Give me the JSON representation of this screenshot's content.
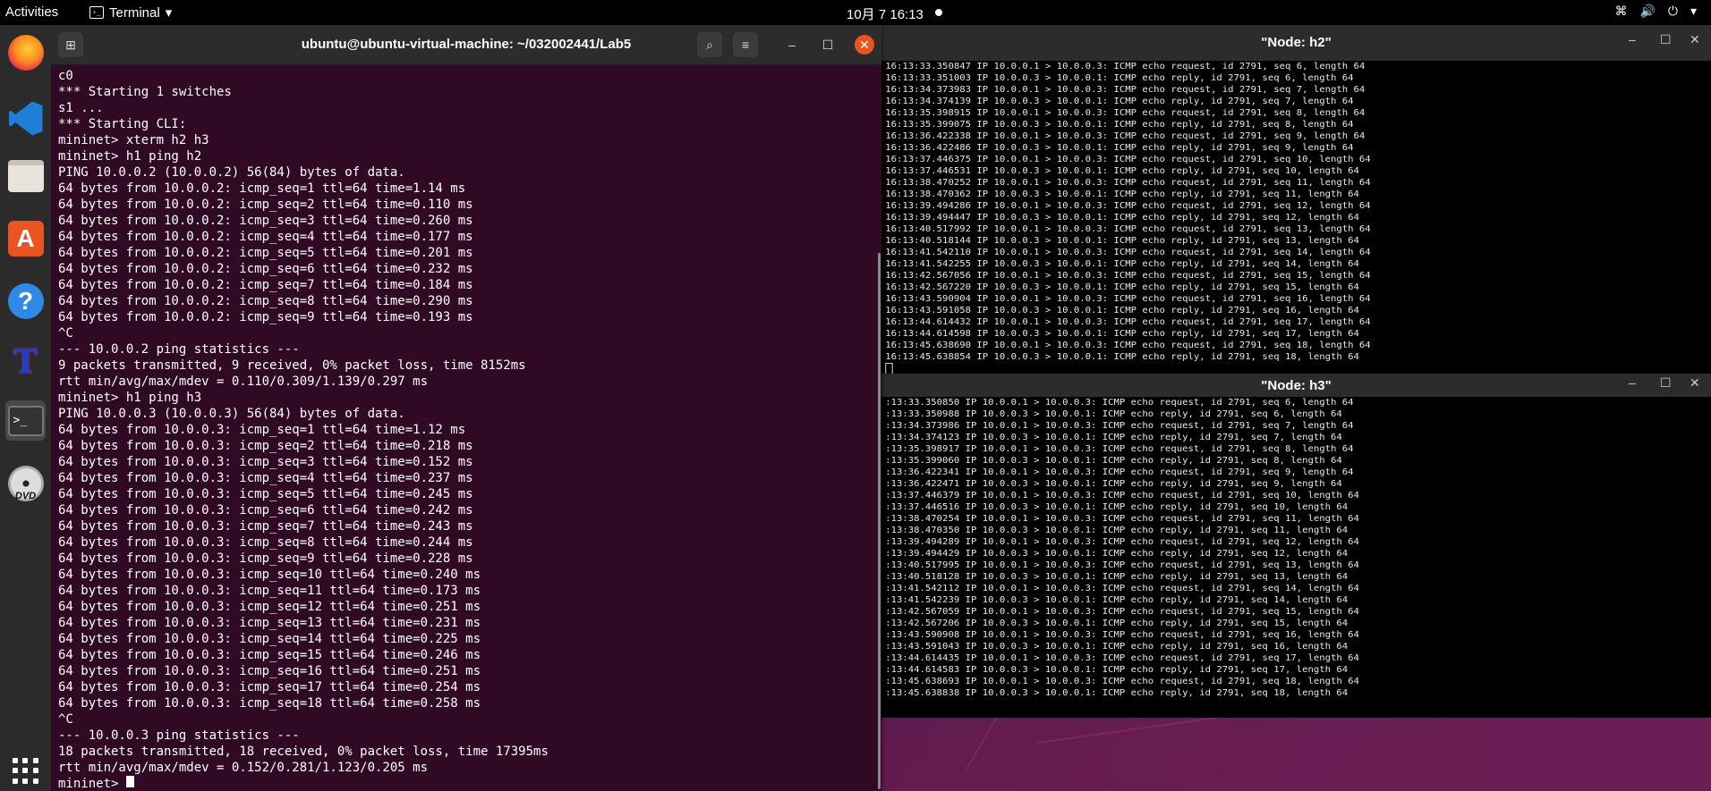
{
  "topbar": {
    "activities": "Activities",
    "app_name": "Terminal",
    "clock": "10月 7  16:13",
    "tray": [
      "⌘",
      "🔊",
      "⏻",
      "▾"
    ]
  },
  "dock": {
    "items": [
      "firefox-icon",
      "vscode-icon",
      "files-icon",
      "app-center-icon",
      "help-icon",
      "tx-icon",
      "terminal-icon",
      "dvd-icon",
      "show-apps-icon"
    ],
    "dvd_label": "DVD"
  },
  "terminal": {
    "title": "ubuntu@ubuntu-virtual-machine: ~/032002441/Lab5",
    "lines": [
      "c0",
      "*** Starting 1 switches",
      "s1 ...",
      "*** Starting CLI:",
      "mininet> xterm h2 h3",
      "mininet> h1 ping h2",
      "PING 10.0.0.2 (10.0.0.2) 56(84) bytes of data.",
      "64 bytes from 10.0.0.2: icmp_seq=1 ttl=64 time=1.14 ms",
      "64 bytes from 10.0.0.2: icmp_seq=2 ttl=64 time=0.110 ms",
      "64 bytes from 10.0.0.2: icmp_seq=3 ttl=64 time=0.260 ms",
      "64 bytes from 10.0.0.2: icmp_seq=4 ttl=64 time=0.177 ms",
      "64 bytes from 10.0.0.2: icmp_seq=5 ttl=64 time=0.201 ms",
      "64 bytes from 10.0.0.2: icmp_seq=6 ttl=64 time=0.232 ms",
      "64 bytes from 10.0.0.2: icmp_seq=7 ttl=64 time=0.184 ms",
      "64 bytes from 10.0.0.2: icmp_seq=8 ttl=64 time=0.290 ms",
      "64 bytes from 10.0.0.2: icmp_seq=9 ttl=64 time=0.193 ms",
      "^C",
      "--- 10.0.0.2 ping statistics ---",
      "9 packets transmitted, 9 received, 0% packet loss, time 8152ms",
      "rtt min/avg/max/mdev = 0.110/0.309/1.139/0.297 ms",
      "mininet> h1 ping h3",
      "PING 10.0.0.3 (10.0.0.3) 56(84) bytes of data.",
      "64 bytes from 10.0.0.3: icmp_seq=1 ttl=64 time=1.12 ms",
      "64 bytes from 10.0.0.3: icmp_seq=2 ttl=64 time=0.218 ms",
      "64 bytes from 10.0.0.3: icmp_seq=3 ttl=64 time=0.152 ms",
      "64 bytes from 10.0.0.3: icmp_seq=4 ttl=64 time=0.237 ms",
      "64 bytes from 10.0.0.3: icmp_seq=5 ttl=64 time=0.245 ms",
      "64 bytes from 10.0.0.3: icmp_seq=6 ttl=64 time=0.242 ms",
      "64 bytes from 10.0.0.3: icmp_seq=7 ttl=64 time=0.243 ms",
      "64 bytes from 10.0.0.3: icmp_seq=8 ttl=64 time=0.244 ms",
      "64 bytes from 10.0.0.3: icmp_seq=9 ttl=64 time=0.228 ms",
      "64 bytes from 10.0.0.3: icmp_seq=10 ttl=64 time=0.240 ms",
      "64 bytes from 10.0.0.3: icmp_seq=11 ttl=64 time=0.173 ms",
      "64 bytes from 10.0.0.3: icmp_seq=12 ttl=64 time=0.251 ms",
      "64 bytes from 10.0.0.3: icmp_seq=13 ttl=64 time=0.231 ms",
      "64 bytes from 10.0.0.3: icmp_seq=14 ttl=64 time=0.225 ms",
      "64 bytes from 10.0.0.3: icmp_seq=15 ttl=64 time=0.246 ms",
      "64 bytes from 10.0.0.3: icmp_seq=16 ttl=64 time=0.251 ms",
      "64 bytes from 10.0.0.3: icmp_seq=17 ttl=64 time=0.254 ms",
      "64 bytes from 10.0.0.3: icmp_seq=18 ttl=64 time=0.258 ms",
      "^C",
      "--- 10.0.0.3 ping statistics ---",
      "18 packets transmitted, 18 received, 0% packet loss, time 17395ms",
      "rtt min/avg/max/mdev = 0.152/0.281/1.123/0.205 ms"
    ],
    "prompt": "mininet> "
  },
  "xterm_h2": {
    "title": "\"Node: h2\"",
    "lines": [
      "16:13:33.350847 IP 10.0.0.1 > 10.0.0.3: ICMP echo request, id 2791, seq 6, length 64",
      "16:13:33.351003 IP 10.0.0.3 > 10.0.0.1: ICMP echo reply, id 2791, seq 6, length 64",
      "16:13:34.373983 IP 10.0.0.1 > 10.0.0.3: ICMP echo request, id 2791, seq 7, length 64",
      "16:13:34.374139 IP 10.0.0.3 > 10.0.0.1: ICMP echo reply, id 2791, seq 7, length 64",
      "16:13:35.398915 IP 10.0.0.1 > 10.0.0.3: ICMP echo request, id 2791, seq 8, length 64",
      "16:13:35.399075 IP 10.0.0.3 > 10.0.0.1: ICMP echo reply, id 2791, seq 8, length 64",
      "16:13:36.422338 IP 10.0.0.1 > 10.0.0.3: ICMP echo request, id 2791, seq 9, length 64",
      "16:13:36.422486 IP 10.0.0.3 > 10.0.0.1: ICMP echo reply, id 2791, seq 9, length 64",
      "16:13:37.446375 IP 10.0.0.1 > 10.0.0.3: ICMP echo request, id 2791, seq 10, length 64",
      "16:13:37.446531 IP 10.0.0.3 > 10.0.0.1: ICMP echo reply, id 2791, seq 10, length 64",
      "16:13:38.470252 IP 10.0.0.1 > 10.0.0.3: ICMP echo request, id 2791, seq 11, length 64",
      "16:13:38.470362 IP 10.0.0.3 > 10.0.0.1: ICMP echo reply, id 2791, seq 11, length 64",
      "16:13:39.494286 IP 10.0.0.1 > 10.0.0.3: ICMP echo request, id 2791, seq 12, length 64",
      "16:13:39.494447 IP 10.0.0.3 > 10.0.0.1: ICMP echo reply, id 2791, seq 12, length 64",
      "16:13:40.517992 IP 10.0.0.1 > 10.0.0.3: ICMP echo request, id 2791, seq 13, length 64",
      "16:13:40.518144 IP 10.0.0.3 > 10.0.0.1: ICMP echo reply, id 2791, seq 13, length 64",
      "16:13:41.542110 IP 10.0.0.1 > 10.0.0.3: ICMP echo request, id 2791, seq 14, length 64",
      "16:13:41.542255 IP 10.0.0.3 > 10.0.0.1: ICMP echo reply, id 2791, seq 14, length 64",
      "16:13:42.567056 IP 10.0.0.1 > 10.0.0.3: ICMP echo request, id 2791, seq 15, length 64",
      "16:13:42.567220 IP 10.0.0.3 > 10.0.0.1: ICMP echo reply, id 2791, seq 15, length 64",
      "16:13:43.590904 IP 10.0.0.1 > 10.0.0.3: ICMP echo request, id 2791, seq 16, length 64",
      "16:13:43.591058 IP 10.0.0.3 > 10.0.0.1: ICMP echo reply, id 2791, seq 16, length 64",
      "16:13:44.614432 IP 10.0.0.1 > 10.0.0.3: ICMP echo request, id 2791, seq 17, length 64",
      "16:13:44.614598 IP 10.0.0.3 > 10.0.0.1: ICMP echo reply, id 2791, seq 17, length 64",
      "16:13:45.638690 IP 10.0.0.1 > 10.0.0.3: ICMP echo request, id 2791, seq 18, length 64",
      "16:13:45.638854 IP 10.0.0.3 > 10.0.0.1: ICMP echo reply, id 2791, seq 18, length 64"
    ]
  },
  "xterm_h3": {
    "title": "\"Node: h3\"",
    "lines": [
      ":13:33.350850 IP 10.0.0.1 > 10.0.0.3: ICMP echo request, id 2791, seq 6, length 64",
      ":13:33.350988 IP 10.0.0.3 > 10.0.0.1: ICMP echo reply, id 2791, seq 6, length 64",
      ":13:34.373986 IP 10.0.0.1 > 10.0.0.3: ICMP echo request, id 2791, seq 7, length 64",
      ":13:34.374123 IP 10.0.0.3 > 10.0.0.1: ICMP echo reply, id 2791, seq 7, length 64",
      ":13:35.398917 IP 10.0.0.1 > 10.0.0.3: ICMP echo request, id 2791, seq 8, length 64",
      ":13:35.399060 IP 10.0.0.3 > 10.0.0.1: ICMP echo reply, id 2791, seq 8, length 64",
      ":13:36.422341 IP 10.0.0.1 > 10.0.0.3: ICMP echo request, id 2791, seq 9, length 64",
      ":13:36.422471 IP 10.0.0.3 > 10.0.0.1: ICMP echo reply, id 2791, seq 9, length 64",
      ":13:37.446379 IP 10.0.0.1 > 10.0.0.3: ICMP echo request, id 2791, seq 10, length 64",
      ":13:37.446516 IP 10.0.0.3 > 10.0.0.1: ICMP echo reply, id 2791, seq 10, length 64",
      ":13:38.470254 IP 10.0.0.1 > 10.0.0.3: ICMP echo request, id 2791, seq 11, length 64",
      ":13:38.470350 IP 10.0.0.3 > 10.0.0.1: ICMP echo reply, id 2791, seq 11, length 64",
      ":13:39.494289 IP 10.0.0.1 > 10.0.0.3: ICMP echo request, id 2791, seq 12, length 64",
      ":13:39.494429 IP 10.0.0.3 > 10.0.0.1: ICMP echo reply, id 2791, seq 12, length 64",
      ":13:40.517995 IP 10.0.0.1 > 10.0.0.3: ICMP echo request, id 2791, seq 13, length 64",
      ":13:40.518128 IP 10.0.0.3 > 10.0.0.1: ICMP echo reply, id 2791, seq 13, length 64",
      ":13:41.542112 IP 10.0.0.1 > 10.0.0.3: ICMP echo request, id 2791, seq 14, length 64",
      ":13:41.542239 IP 10.0.0.3 > 10.0.0.1: ICMP echo reply, id 2791, seq 14, length 64",
      ":13:42.567059 IP 10.0.0.1 > 10.0.0.3: ICMP echo request, id 2791, seq 15, length 64",
      ":13:42.567206 IP 10.0.0.3 > 10.0.0.1: ICMP echo reply, id 2791, seq 15, length 64",
      ":13:43.590908 IP 10.0.0.1 > 10.0.0.3: ICMP echo request, id 2791, seq 16, length 64",
      ":13:43.591043 IP 10.0.0.3 > 10.0.0.1: ICMP echo reply, id 2791, seq 16, length 64",
      ":13:44.614435 IP 10.0.0.1 > 10.0.0.3: ICMP echo request, id 2791, seq 17, length 64",
      ":13:44.614583 IP 10.0.0.3 > 10.0.0.1: ICMP echo reply, id 2791, seq 17, length 64",
      ":13:45.638693 IP 10.0.0.1 > 10.0.0.3: ICMP echo request, id 2791, seq 18, length 64",
      ":13:45.638838 IP 10.0.0.3 > 10.0.0.1: ICMP echo reply, id 2791, seq 18, length 64"
    ]
  },
  "window_controls": {
    "minimize": "–",
    "maximize": "☐",
    "close": "✕"
  },
  "colors": {
    "terminal_bg": "#300a24",
    "accent": "#e95420",
    "xterm_bg": "#000000"
  }
}
